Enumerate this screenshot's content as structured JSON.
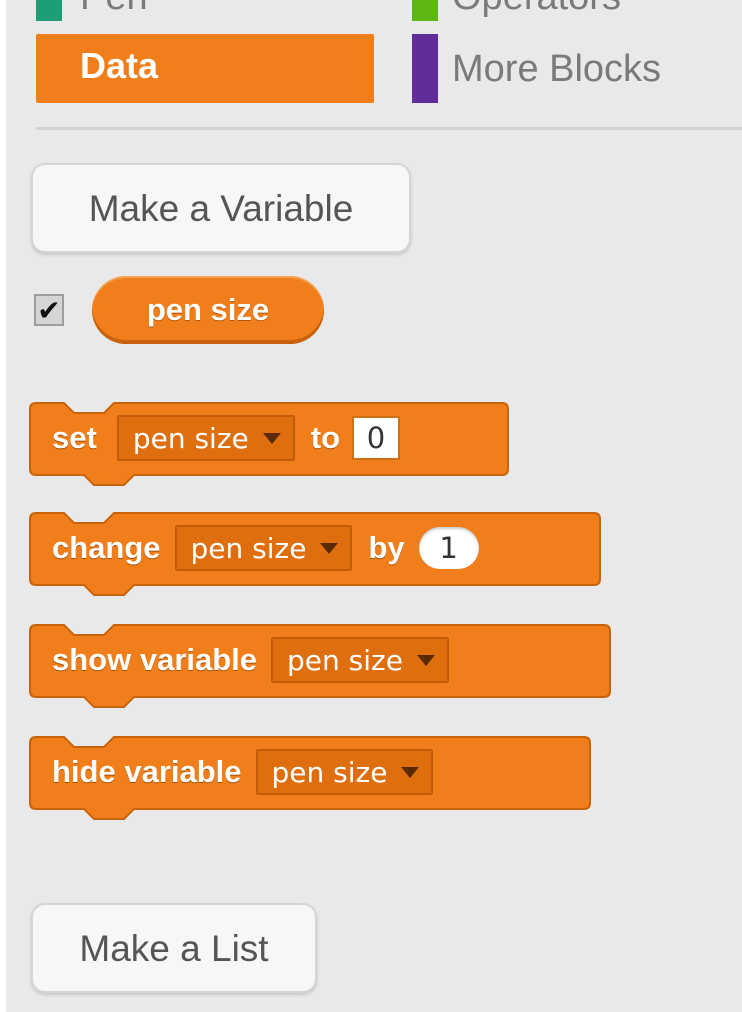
{
  "categories": [
    {
      "label": "Pen",
      "color": "#1e9e76"
    },
    {
      "label": "Operators",
      "color": "#5cb712"
    },
    {
      "label": "Data",
      "color": "#ef7e1b",
      "selected": true
    },
    {
      "label": "More Blocks",
      "color": "#632d99"
    }
  ],
  "buttons": {
    "make_variable": "Make a Variable",
    "make_list": "Make a List"
  },
  "variable": {
    "checked": true,
    "check_glyph": "✔",
    "name": "pen size"
  },
  "blocks": [
    {
      "parts": [
        "set",
        "pen size",
        "to",
        "0"
      ]
    },
    {
      "parts": [
        "change",
        "pen size",
        "by",
        "1"
      ]
    },
    {
      "parts": [
        "show variable",
        "pen size"
      ]
    },
    {
      "parts": [
        "hide variable",
        "pen size"
      ]
    }
  ],
  "colors": {
    "data_orange": "#ef7e1b",
    "palette_bg": "#e9e9e9"
  }
}
